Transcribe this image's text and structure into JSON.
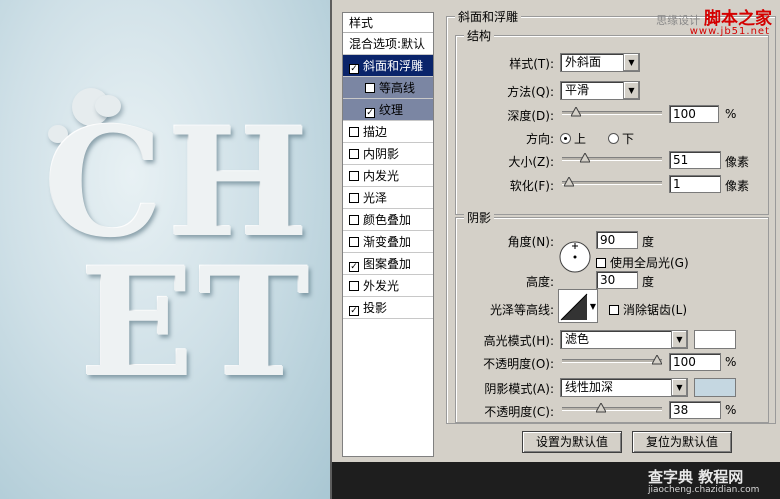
{
  "canvas": {
    "line1": "CH",
    "line2": "ET"
  },
  "watermark": {
    "prefix": "思缘设计",
    "brand": "脚本之家",
    "url": "www.jb51.net",
    "bottom_brand": "查字典 教程网",
    "bottom_url": "jiaocheng.chazidian.com"
  },
  "styles_panel": {
    "header": "样式",
    "blend_options": "混合选项:默认",
    "items": [
      {
        "label": "斜面和浮雕",
        "checked": true,
        "selected": true,
        "sub": false
      },
      {
        "label": "等高线",
        "checked": false,
        "selected": false,
        "sub": true
      },
      {
        "label": "纹理",
        "checked": true,
        "selected": false,
        "sub": true
      },
      {
        "label": "描边",
        "checked": false,
        "selected": false,
        "sub": false
      },
      {
        "label": "内阴影",
        "checked": false,
        "selected": false,
        "sub": false
      },
      {
        "label": "内发光",
        "checked": false,
        "selected": false,
        "sub": false
      },
      {
        "label": "光泽",
        "checked": false,
        "selected": false,
        "sub": false
      },
      {
        "label": "颜色叠加",
        "checked": false,
        "selected": false,
        "sub": false
      },
      {
        "label": "渐变叠加",
        "checked": false,
        "selected": false,
        "sub": false
      },
      {
        "label": "图案叠加",
        "checked": true,
        "selected": false,
        "sub": false
      },
      {
        "label": "外发光",
        "checked": false,
        "selected": false,
        "sub": false
      },
      {
        "label": "投影",
        "checked": true,
        "selected": false,
        "sub": false
      }
    ]
  },
  "bevel": {
    "title": "斜面和浮雕",
    "structure": {
      "title": "结构",
      "style_label": "样式(T):",
      "style_value": "外斜面",
      "technique_label": "方法(Q):",
      "technique_value": "平滑",
      "depth_label": "深度(D):",
      "depth_value": "100",
      "depth_unit": "%",
      "depth_fraction": 0.1,
      "direction_label": "方向:",
      "direction_up": "上",
      "direction_down": "下",
      "direction_selected": "up",
      "size_label": "大小(Z):",
      "size_value": "51",
      "size_unit": "像素",
      "size_fraction": 0.2,
      "soften_label": "软化(F):",
      "soften_value": "1",
      "soften_unit": "像素",
      "soften_fraction": 0.02
    },
    "shading": {
      "title": "阴影",
      "angle_label": "角度(N):",
      "angle_value": "90",
      "angle_unit": "度",
      "global_light_label": "使用全局光(G)",
      "global_light_checked": false,
      "altitude_label": "高度:",
      "altitude_value": "30",
      "altitude_unit": "度",
      "gloss_label": "光泽等高线:",
      "antialias_label": "消除锯齿(L)",
      "antialias_checked": false,
      "highlight_mode_label": "高光模式(H):",
      "highlight_mode_value": "滤色",
      "highlight_color": "#ffffff",
      "highlight_opacity_label": "不透明度(O):",
      "highlight_opacity_value": "100",
      "highlight_opacity_unit": "%",
      "highlight_opacity_fraction": 1.0,
      "shadow_mode_label": "阴影模式(A):",
      "shadow_mode_value": "线性加深",
      "shadow_color": "#c5d7e1",
      "shadow_opacity_label": "不透明度(C):",
      "shadow_opacity_value": "38",
      "shadow_opacity_unit": "%",
      "shadow_opacity_fraction": 0.38
    },
    "make_default": "设置为默认值",
    "reset_default": "复位为默认值"
  }
}
